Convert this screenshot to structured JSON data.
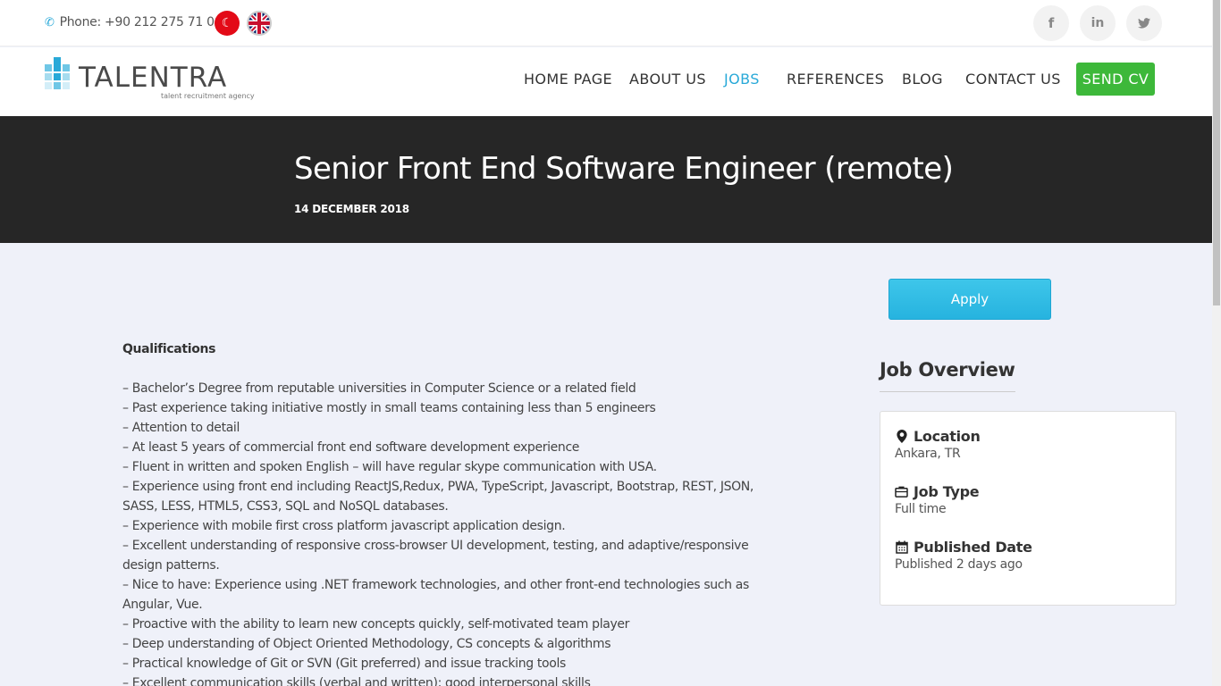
{
  "topbar": {
    "phone": "Phone: +90 212 275 71 06",
    "social": {
      "facebook": "f",
      "linkedin": "in",
      "twitter": "t"
    }
  },
  "nav": {
    "logo_text": "TALENTRA",
    "logo_sub": "talent recruitment agency",
    "items": [
      "HOME PAGE",
      "ABOUT US",
      "JOBS",
      "REFERENCES",
      "BLOG",
      "CONTACT US"
    ],
    "send_cv": "SEND CV",
    "active_color": "#29a9d8"
  },
  "header": {
    "title": "Senior Front End Software Engineer (remote)",
    "date": "14 DECEMBER 2018"
  },
  "description": {
    "heading": "Qualifications",
    "lines": [
      "– Bachelor’s Degree from reputable universities in Computer Science or a related field",
      "– Past experience taking initiative mostly in small teams containing less than 5 engineers",
      "– Attention to detail",
      "– At least 5 years of commercial front end software development experience",
      "– Fluent in written and spoken English – will have regular skype communication with USA.",
      "– Experience using front end including ReactJS,Redux, PWA, TypeScript, Javascript, Bootstrap, REST, JSON, SASS, LESS, HTML5, CSS3, SQL and NoSQL databases.",
      "– Experience with mobile first cross platform javascript application design.",
      "– Excellent understanding of responsive cross-browser UI development, testing, and adaptive/responsive design patterns.",
      "– Nice to have: Experience using .NET framework technologies, and other front-end technologies such as Angular, Vue.",
      " – Proactive with the ability to learn new concepts quickly, self-motivated team player",
      "– Deep understanding of Object Oriented Methodology, CS concepts & algorithms",
      "–  Practical knowledge of Git or SVN (Git preferred) and issue tracking tools",
      "–  Excellent communication skills (verbal and written); good interpersonal skills"
    ]
  },
  "sidebar": {
    "apply": "Apply",
    "overview_title": "Job Overview",
    "location_label": "Location",
    "location_value": "Ankara, TR",
    "jobtype_label": "Job Type",
    "jobtype_value": "Full time",
    "published_label": "Published Date",
    "published_value": "Published 2 days ago"
  }
}
